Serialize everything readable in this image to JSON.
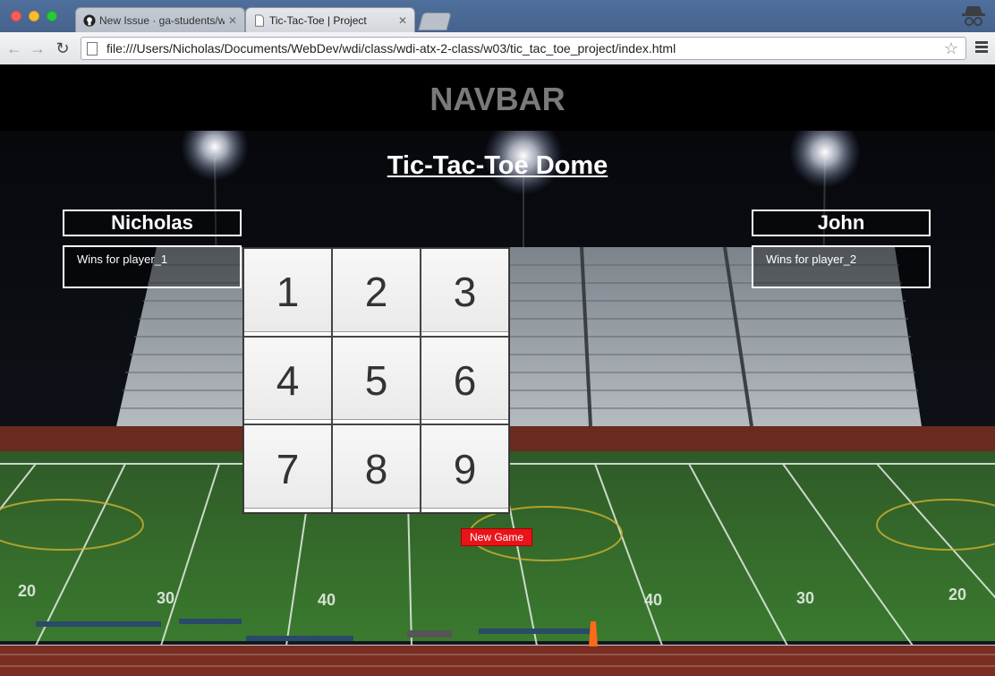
{
  "browser": {
    "tabs": [
      {
        "title": "New Issue · ga-students/wd",
        "active": false
      },
      {
        "title": "Tic-Tac-Toe | Project",
        "active": true
      }
    ],
    "url": "file:///Users/Nicholas/Documents/WebDev/wdi/class/wdi-atx-2-class/w03/tic_tac_toe_project/index.html"
  },
  "page": {
    "navbar": "NAVBAR",
    "heading": "Tic-Tac-Toe Dome",
    "player1": {
      "name": "Nicholas",
      "wins_placeholder": "Wins for player_1"
    },
    "player2": {
      "name": "John",
      "wins_placeholder": "Wins for player_2"
    },
    "board": [
      "1",
      "2",
      "3",
      "4",
      "5",
      "6",
      "7",
      "8",
      "9"
    ],
    "new_game_label": "New Game"
  },
  "colors": {
    "navbar_text": "#7a7a7a",
    "new_game_button": "#e8141a",
    "field_green": "#2f6a2a"
  }
}
